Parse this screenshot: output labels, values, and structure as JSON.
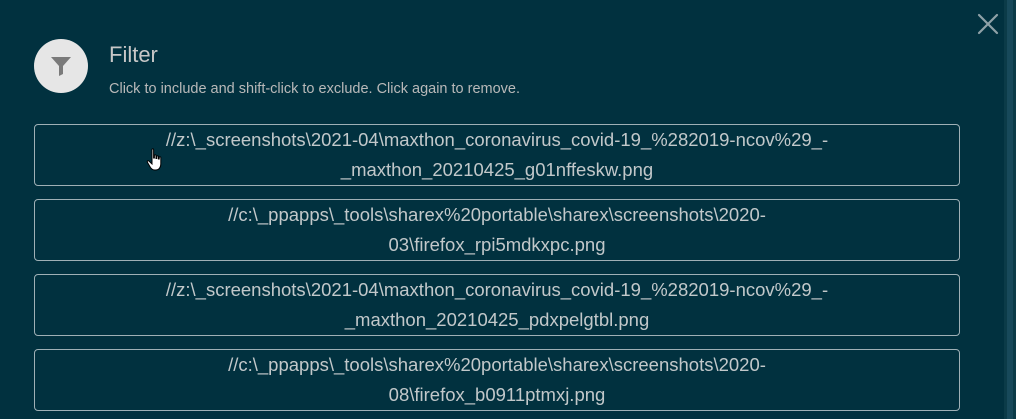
{
  "dialog": {
    "title": "Filter",
    "subtitle": "Click to include and shift-click to exclude. Click again to remove.",
    "icons": {
      "badge": "filter-icon",
      "close": "close-icon"
    },
    "colors": {
      "background": "#01313f",
      "badge": "#e6e6e6",
      "border": "#9fb0b6",
      "text": "#c2c8ca"
    }
  },
  "options": [
    {
      "line1": "//z:\\_screenshots\\2021-04\\maxthon_coronavirus_covid-19_%282019-ncov%29_-",
      "line2": "_maxthon_20210425_g01nffeskw.png"
    },
    {
      "line1": "//c:\\_ppapps\\_tools\\sharex%20portable\\sharex\\screenshots\\2020-",
      "line2": "03\\firefox_rpi5mdkxpc.png"
    },
    {
      "line1": "//z:\\_screenshots\\2021-04\\maxthon_coronavirus_covid-19_%282019-ncov%29_-",
      "line2": "_maxthon_20210425_pdxpelgtbl.png"
    },
    {
      "line1": "//c:\\_ppapps\\_tools\\sharex%20portable\\sharex\\screenshots\\2020-",
      "line2": "08\\firefox_b0911ptmxj.png"
    }
  ]
}
